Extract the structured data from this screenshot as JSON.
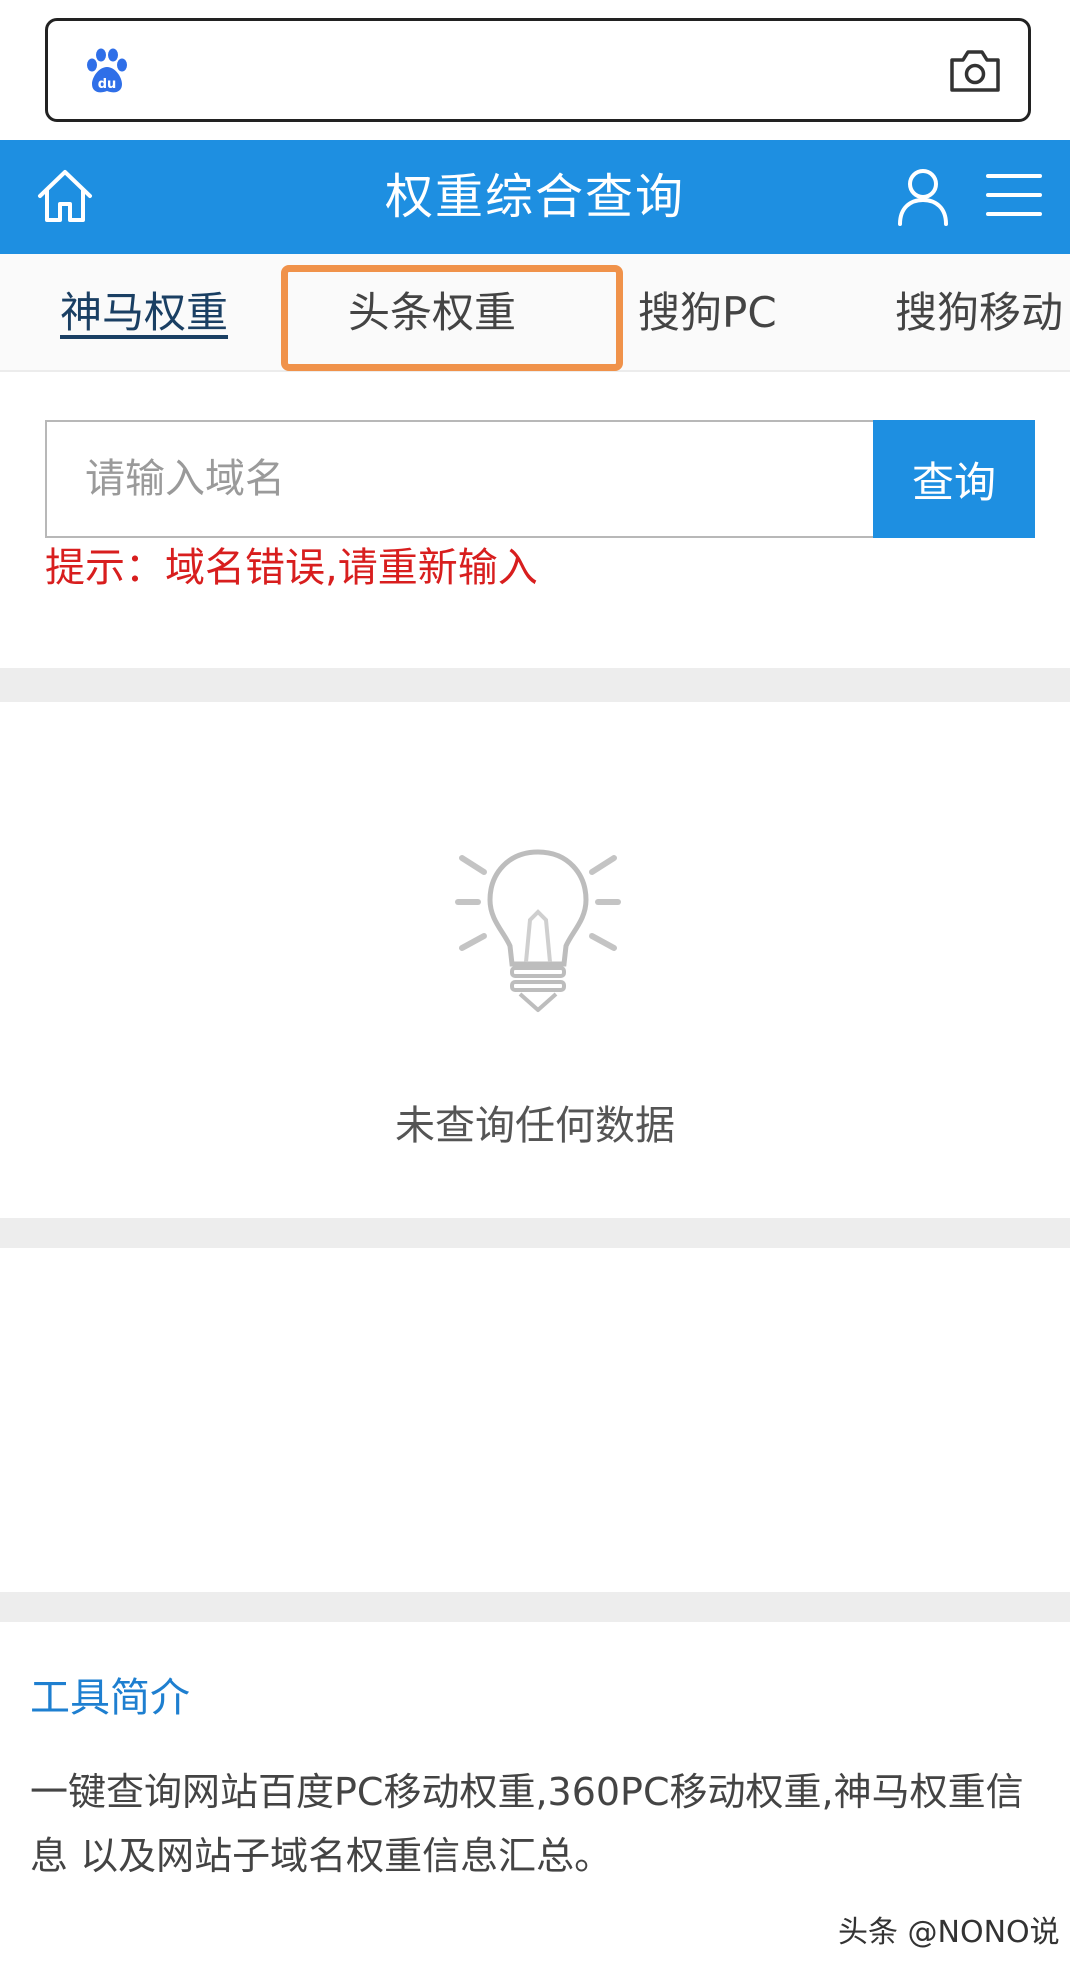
{
  "browser": {
    "logo_text": "du",
    "icons": {
      "logo": "baidu-paw-logo",
      "camera": "camera-icon"
    }
  },
  "header": {
    "title": "权重综合查询",
    "background": "#1e8fe1",
    "icons": {
      "home": "home-icon",
      "user": "user-icon",
      "menu": "menu-icon"
    }
  },
  "tabs": [
    {
      "label": "神马权重"
    },
    {
      "label": "头条权重"
    },
    {
      "label": "搜狗PC"
    },
    {
      "label": "搜狗移动"
    }
  ],
  "highlight_color": "#f0924a",
  "search": {
    "placeholder": "请输入域名",
    "value": "",
    "button_label": "查询",
    "error_hint": "提示：域名错误,请重新输入"
  },
  "empty_state": {
    "icon": "lightbulb-icon",
    "text": "未查询任何数据"
  },
  "intro": {
    "title": "工具简介",
    "body": "一键查询网站百度PC移动权重,360PC移动权重,神马权重信息 以及网站子域名权重信息汇总。"
  },
  "watermark": "头条 @NONO说"
}
